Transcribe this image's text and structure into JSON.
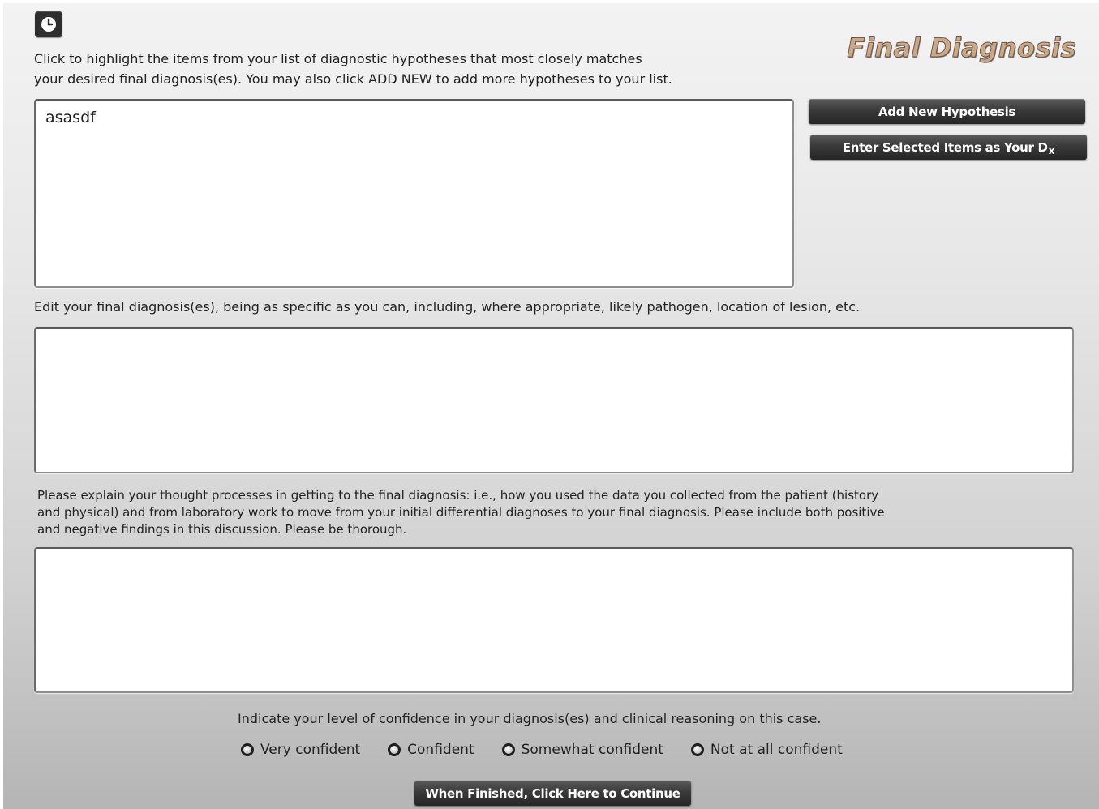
{
  "header": {
    "title": "Final Diagnosis",
    "clock_icon": "clock-icon"
  },
  "instructions": {
    "highlight_line1": "Click to highlight the items from your list of diagnostic hypotheses that most closely matches",
    "highlight_line2": "your desired final diagnosis(es). You may also click ADD NEW to add more hypotheses to your list.",
    "edit": "Edit your final diagnosis(es), being as specific as you can, including, where appropriate, likely pathogen, location of lesion, etc.",
    "explain_line1": "Please explain your thought processes in getting to the final diagnosis: i.e., how you used the data you collected from the patient (history",
    "explain_line2": "and physical) and from laboratory work to move from your initial differential diagnoses to your final diagnosis. Please include both positive",
    "explain_line3": "and negative findings in this discussion. Please be thorough.",
    "confidence": "Indicate your level of confidence in your diagnosis(es) and clinical reasoning on this case."
  },
  "hypotheses": {
    "items": [
      "asasdf"
    ]
  },
  "buttons": {
    "add_new": "Add New Hypothesis",
    "enter_selected": "Enter Selected Items as Your D",
    "enter_selected_sub": "x",
    "continue": "When Finished, Click Here to Continue"
  },
  "fields": {
    "final_diagnosis_value": "",
    "reasoning_value": ""
  },
  "confidence_options": [
    {
      "label": "Very confident"
    },
    {
      "label": "Confident"
    },
    {
      "label": "Somewhat confident"
    },
    {
      "label": "Not at all confident"
    }
  ],
  "colors": {
    "title": "#c9a98a",
    "button": "#3a3a3a"
  }
}
